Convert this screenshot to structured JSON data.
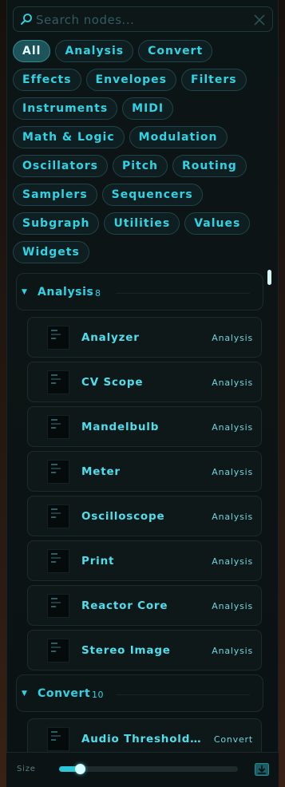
{
  "search": {
    "placeholder": "Search nodes...",
    "value": ""
  },
  "filters": [
    {
      "label": "All",
      "active": true
    },
    {
      "label": "Analysis"
    },
    {
      "label": "Convert"
    },
    {
      "label": "Effects"
    },
    {
      "label": "Envelopes"
    },
    {
      "label": "Filters"
    },
    {
      "label": "Instruments"
    },
    {
      "label": "MIDI"
    },
    {
      "label": "Math & Logic"
    },
    {
      "label": "Modulation"
    },
    {
      "label": "Oscillators"
    },
    {
      "label": "Pitch"
    },
    {
      "label": "Routing"
    },
    {
      "label": "Samplers"
    },
    {
      "label": "Sequencers"
    },
    {
      "label": "Subgraph"
    },
    {
      "label": "Utilities"
    },
    {
      "label": "Values"
    },
    {
      "label": "Widgets"
    }
  ],
  "groups": [
    {
      "name": "Analysis",
      "count": "8",
      "items": [
        {
          "name": "Analyzer",
          "category": "Analysis"
        },
        {
          "name": "CV Scope",
          "category": "Analysis"
        },
        {
          "name": "Mandelbulb",
          "category": "Analysis"
        },
        {
          "name": "Meter",
          "category": "Analysis"
        },
        {
          "name": "Oscilloscope",
          "category": "Analysis"
        },
        {
          "name": "Print",
          "category": "Analysis"
        },
        {
          "name": "Reactor Core",
          "category": "Analysis"
        },
        {
          "name": "Stereo Image",
          "category": "Analysis"
        }
      ]
    },
    {
      "name": "Convert",
      "count": "10",
      "items": [
        {
          "name": "Audio Threshold T...",
          "category": "Convert"
        }
      ]
    }
  ],
  "footer": {
    "size_label": "Size",
    "size_value": 0.1
  },
  "colors": {
    "accent": "#2fd3e3",
    "active_chip": "#1d5359",
    "background": "#0c1516"
  },
  "icons": {
    "search": "magnifier-icon",
    "clear": "close-icon",
    "download": "download-icon",
    "caret": "caret-down-icon"
  }
}
